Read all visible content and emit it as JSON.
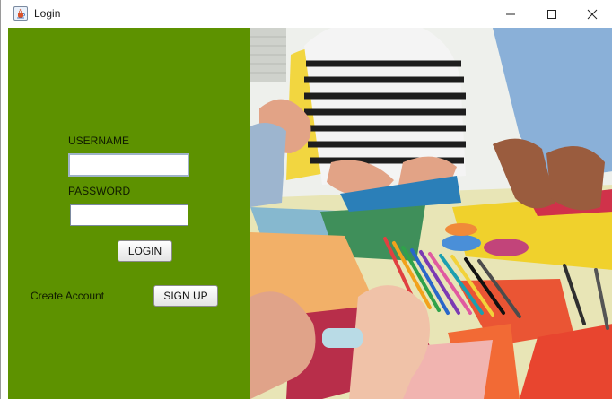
{
  "window": {
    "title": "Login",
    "icon": "java-cup-icon",
    "controls": [
      "minimize-icon",
      "maximize-icon",
      "close-icon"
    ]
  },
  "form": {
    "username_label": "USERNAME",
    "username_value": "",
    "password_label": "PASSWORD",
    "password_value": "",
    "login_button": "LOGIN",
    "create_account_label": "Create  Account",
    "signup_button": "SIGN UP"
  },
  "image": {
    "subject": "children doing paper crafts at a table"
  },
  "colors": {
    "panel": "#5d9200",
    "label_text": "#0f1a00"
  }
}
